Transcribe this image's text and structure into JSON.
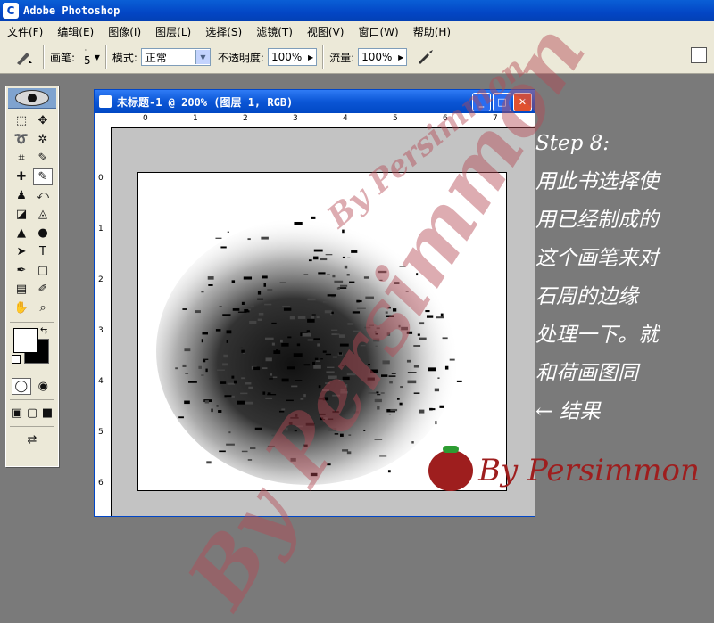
{
  "app": {
    "title": "Adobe Photoshop",
    "logo_letter": "C"
  },
  "menu": [
    "文件(F)",
    "编辑(E)",
    "图像(I)",
    "图层(L)",
    "选择(S)",
    "滤镜(T)",
    "视图(V)",
    "窗口(W)",
    "帮助(H)"
  ],
  "options": {
    "brush_label": "画笔:",
    "brush_size": "5",
    "mode_label": "模式:",
    "mode_value": "正常",
    "opacity_label": "不透明度:",
    "opacity_value": "100%",
    "flow_label": "流量:",
    "flow_value": "100%"
  },
  "document": {
    "title": "未标题-1 @ 200% (图层 1, RGB)",
    "ruler_h": [
      "0",
      "1",
      "2",
      "3",
      "4",
      "5",
      "6",
      "7"
    ],
    "ruler_v": [
      "0",
      "1",
      "2",
      "3",
      "4",
      "5",
      "6"
    ]
  },
  "tools": [
    [
      "marquee-tool",
      "⬚"
    ],
    [
      "move-tool",
      "✥"
    ],
    [
      "lasso-tool",
      "➰"
    ],
    [
      "magic-wand-tool",
      "✲"
    ],
    [
      "crop-tool",
      "⌗"
    ],
    [
      "slice-tool",
      "✎"
    ],
    [
      "healing-brush-tool",
      "✚"
    ],
    [
      "brush-tool",
      "✎"
    ],
    [
      "clone-stamp-tool",
      "♟"
    ],
    [
      "history-brush-tool",
      "⤺"
    ],
    [
      "eraser-tool",
      "◪"
    ],
    [
      "paint-bucket-tool",
      "◬"
    ],
    [
      "blur-tool",
      "▲"
    ],
    [
      "dodge-tool",
      "●"
    ],
    [
      "path-selection-tool",
      "➤"
    ],
    [
      "type-tool",
      "T"
    ],
    [
      "pen-tool",
      "✒"
    ],
    [
      "shape-tool",
      "▢"
    ],
    [
      "notes-tool",
      "▤"
    ],
    [
      "eyedropper-tool",
      "✐"
    ],
    [
      "hand-tool",
      "✋"
    ],
    [
      "zoom-tool",
      "⌕"
    ]
  ],
  "notes": [
    "Step 8:",
    "用此书选择使",
    "用已经制成的",
    "这个画笔来对",
    "石周的边缘",
    "处理一下。就",
    "和荷画图同",
    "← 结果"
  ],
  "watermark": {
    "text": "By Persimmon",
    "signature": "By Persimmon"
  },
  "colors": {
    "title_blue": "#0346c5",
    "note_white": "#ffffff",
    "watermark_red": "#b44a55"
  }
}
